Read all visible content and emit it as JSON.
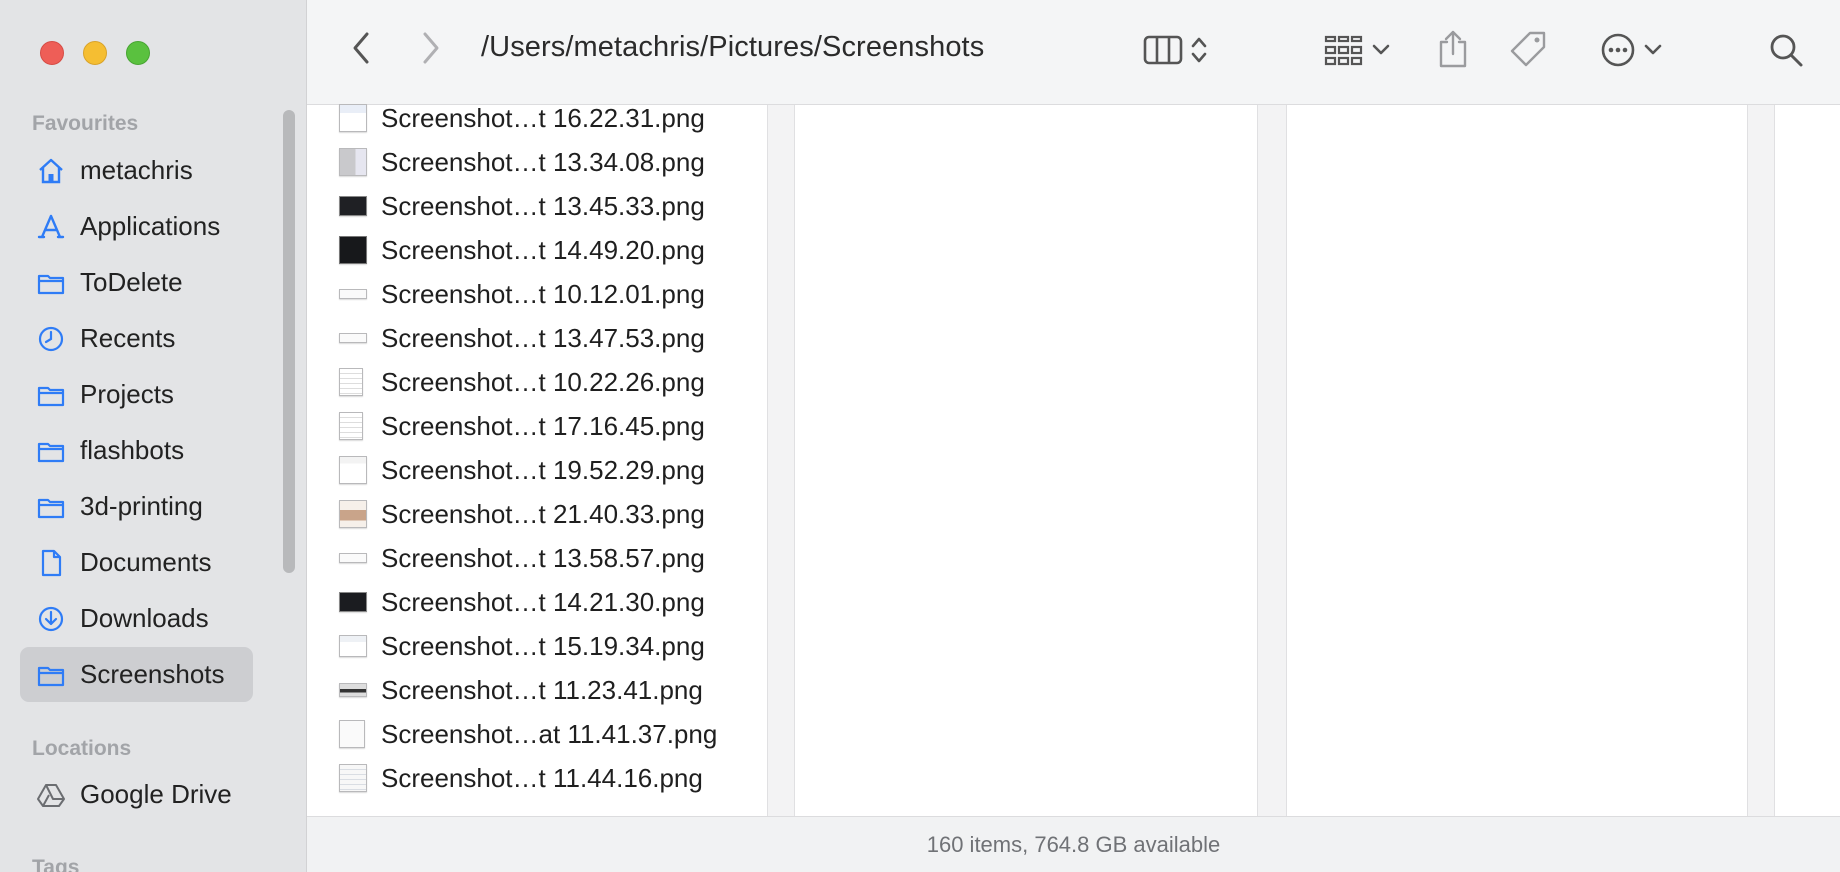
{
  "window": {
    "path_title": "/Users/metachris/Pictures/Screenshots",
    "traffic_lights": [
      "close",
      "minimize",
      "zoom"
    ]
  },
  "sidebar": {
    "favourites_title": "Favourites",
    "favourites": [
      {
        "label": "metachris",
        "icon": "home-icon"
      },
      {
        "label": "Applications",
        "icon": "applications-icon"
      },
      {
        "label": "ToDelete",
        "icon": "folder-icon"
      },
      {
        "label": "Recents",
        "icon": "clock-icon"
      },
      {
        "label": "Projects",
        "icon": "folder-icon"
      },
      {
        "label": "flashbots",
        "icon": "folder-icon"
      },
      {
        "label": "3d-printing",
        "icon": "folder-icon"
      },
      {
        "label": "Documents",
        "icon": "document-icon"
      },
      {
        "label": "Downloads",
        "icon": "download-icon"
      },
      {
        "label": "Screenshots",
        "icon": "folder-icon",
        "selected": true
      }
    ],
    "locations_title": "Locations",
    "locations": [
      {
        "label": "Google Drive",
        "icon": "google-drive-icon"
      }
    ],
    "tags_title": "Tags"
  },
  "files": [
    {
      "name": "Screenshot…t 16.22.31.png",
      "thumb": "light-ui"
    },
    {
      "name": "Screenshot…t 13.34.08.png",
      "thumb": "grey-ui"
    },
    {
      "name": "Screenshot…t 13.45.33.png",
      "thumb": "dark"
    },
    {
      "name": "Screenshot…t 14.49.20.png",
      "thumb": "dark"
    },
    {
      "name": "Screenshot…t 10.12.01.png",
      "thumb": "strip"
    },
    {
      "name": "Screenshot…t 13.47.53.png",
      "thumb": "strip"
    },
    {
      "name": "Screenshot…t 10.22.26.png",
      "thumb": "document"
    },
    {
      "name": "Screenshot…t 17.16.45.png",
      "thumb": "document"
    },
    {
      "name": "Screenshot…t 19.52.29.png",
      "thumb": "light-ui"
    },
    {
      "name": "Screenshot…t 21.40.33.png",
      "thumb": "photo"
    },
    {
      "name": "Screenshot…t 13.58.57.png",
      "thumb": "strip"
    },
    {
      "name": "Screenshot…t 14.21.30.png",
      "thumb": "dark"
    },
    {
      "name": "Screenshot…t 15.19.34.png",
      "thumb": "light-ui"
    },
    {
      "name": "Screenshot…t 11.23.41.png",
      "thumb": "strip-dark"
    },
    {
      "name": "Screenshot…at 11.41.37.png",
      "thumb": "document"
    },
    {
      "name": "Screenshot…t 11.44.16.png",
      "thumb": "document"
    }
  ],
  "statusbar": {
    "text": "160 items, 764.8 GB available"
  },
  "colors": {
    "accent": "#2f7cf6",
    "sidebar_bg": "#e3e4e6",
    "selected_bg": "#cdced1"
  }
}
